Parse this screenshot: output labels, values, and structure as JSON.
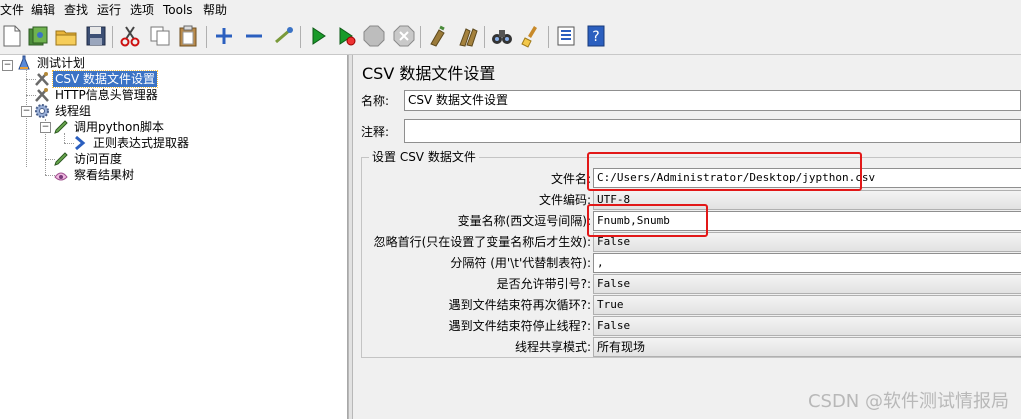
{
  "menu": [
    "文件",
    "编辑",
    "查找",
    "运行",
    "选项",
    "Tools",
    "帮助"
  ],
  "tree": {
    "root": "测试计划",
    "csv_config": "CSV 数据文件设置",
    "http_header": "HTTP信息头管理器",
    "thread_group": "线程组",
    "python_script": "调用python脚本",
    "regex_extractor": "正则表达式提取器",
    "visit_baidu": "访问百度",
    "view_results": "察看结果树"
  },
  "panel": {
    "title": "CSV 数据文件设置",
    "name_label": "名称:",
    "name_value": "CSV 数据文件设置",
    "comment_label": "注释:",
    "comment_value": "",
    "group_title": "设置 CSV 数据文件",
    "filename_label": "文件名:",
    "filename_value": "C:/Users/Administrator/Desktop/jypthon.csv",
    "encoding_label": "文件编码:",
    "encoding_value": "UTF-8",
    "varnames_label": "变量名称(西文逗号间隔):",
    "varnames_value": "Fnumb,Snumb",
    "ignore_label": "忽略首行(只在设置了变量名称后才生效):",
    "ignore_value": "False",
    "delimiter_label": "分隔符 (用'\\t'代替制表符):",
    "delimiter_value": ",",
    "quoted_label": "是否允许带引号?:",
    "quoted_value": "False",
    "recycle_label": "遇到文件结束符再次循环?:",
    "recycle_value": "True",
    "stop_label": "遇到文件结束符停止线程?:",
    "stop_value": "False",
    "share_label": "线程共享模式:",
    "share_value": "所有现场"
  },
  "watermark": "CSDN @软件测试情报局",
  "colors": {
    "selection": "#3b73c5",
    "highlight": "#e21818",
    "run": "#1a9a2a"
  }
}
